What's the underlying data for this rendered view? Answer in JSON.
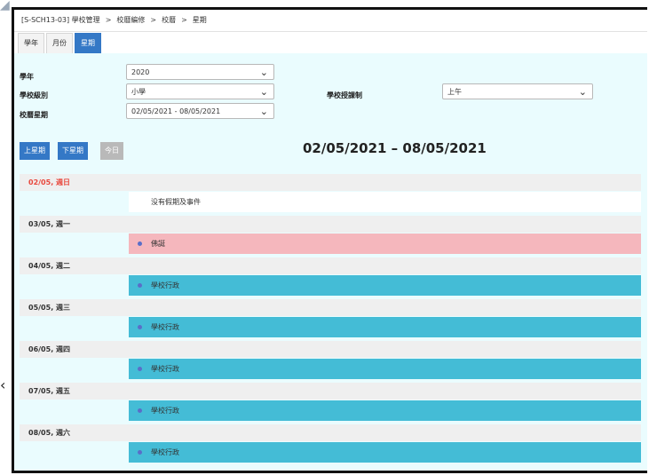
{
  "breadcrumb": [
    "[S-SCH13-03] 學校管理",
    "校曆編修",
    "校曆",
    "星期"
  ],
  "tabs": [
    "學年",
    "月份",
    "星期"
  ],
  "active_tab": "星期",
  "filters": {
    "year_label": "學年",
    "year_value": "2020",
    "level_label": "學校級別",
    "level_value": "小學",
    "week_label": "校曆星期",
    "week_value": "02/05/2021 - 08/05/2021",
    "session_label": "學校授課制",
    "session_value": "上午"
  },
  "buttons": {
    "prev_week": "上星期",
    "next_week": "下星期",
    "today": "今日"
  },
  "range_title": "02/05/2021 – 08/05/2021",
  "days": [
    {
      "head": "02/05, 週日",
      "event": "没有假期及事件"
    },
    {
      "head": "03/05, 週一",
      "event": "佛誕"
    },
    {
      "head": "04/05, 週二",
      "event": "學校行政"
    },
    {
      "head": "05/05, 週三",
      "event": "學校行政"
    },
    {
      "head": "06/05, 週四",
      "event": "學校行政"
    },
    {
      "head": "07/05, 週五",
      "event": "學校行政"
    },
    {
      "head": "08/05, 週六",
      "event": "學校行政"
    }
  ],
  "colors": {
    "accent": "#3478c6",
    "holiday": "#f5b7bd",
    "admin": "#44bcd6",
    "sunday": "#e8473c"
  }
}
